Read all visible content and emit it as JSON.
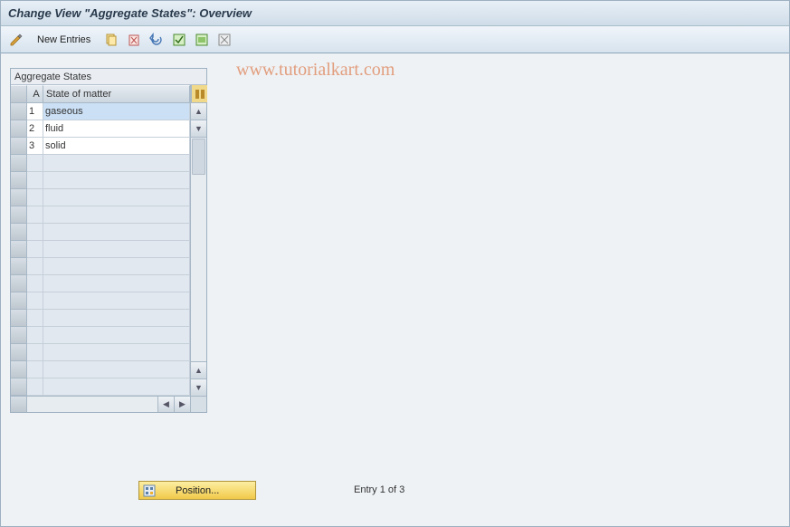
{
  "title": "Change View \"Aggregate States\": Overview",
  "watermark": "www.tutorialkart.com",
  "toolbar": {
    "new_entries_label": "New Entries"
  },
  "group": {
    "title": "Aggregate States",
    "columns": {
      "a": "A",
      "b": "State of matter"
    },
    "rows": [
      {
        "a": "1",
        "b": "gaseous",
        "selected": true
      },
      {
        "a": "2",
        "b": "fluid",
        "selected": false
      },
      {
        "a": "3",
        "b": "solid",
        "selected": false
      }
    ],
    "empty_row_count": 14
  },
  "position_button": "Position...",
  "entry_status": "Entry 1 of 3"
}
